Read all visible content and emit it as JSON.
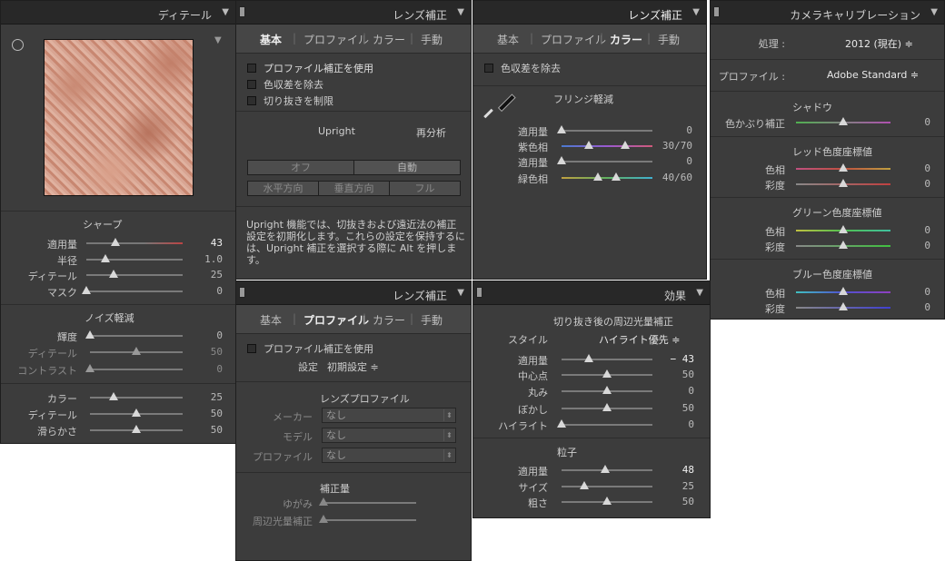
{
  "detail": {
    "title": "ディテール",
    "sharpen": {
      "title": "シャープ",
      "rows": [
        {
          "label": "適用量",
          "value": "43"
        },
        {
          "label": "半径",
          "value": "1.0"
        },
        {
          "label": "ディテール",
          "value": "25"
        },
        {
          "label": "マスク",
          "value": "0"
        }
      ]
    },
    "noise": {
      "title": "ノイズ軽減",
      "rows": [
        {
          "label": "輝度",
          "value": "0"
        },
        {
          "label": "ディテール",
          "value": "50"
        },
        {
          "label": "コントラスト",
          "value": "0"
        },
        {
          "label": "カラー",
          "value": "25"
        },
        {
          "label": "ディテール",
          "value": "50"
        },
        {
          "label": "滑らかさ",
          "value": "50"
        }
      ]
    }
  },
  "lens1": {
    "title": "レンズ補正",
    "tabs": [
      "基本",
      "プロファイル",
      "カラー",
      "手動"
    ],
    "active_tab": "基本",
    "checkboxes": [
      "プロファイル補正を使用",
      "色収差を除去",
      "切り抜きを制限"
    ],
    "upright": "Upright",
    "reanalyze": "再分析",
    "buttons_row1": [
      "オフ",
      "自動"
    ],
    "buttons_row2": [
      "水平方向",
      "垂直方向",
      "フル"
    ],
    "info": "Upright 機能では、切抜きおよび遠近法の補正設定を初期化します。これらの設定を保持するには、Upright 補正を選択する際に Alt を押します。"
  },
  "lens2": {
    "title": "レンズ補正",
    "tabs": [
      "基本",
      "プロファイル",
      "カラー",
      "手動"
    ],
    "active_tab": "カラー",
    "checkbox": "色収差を除去",
    "fringe_title": "フリンジ軽減",
    "rows": [
      {
        "label": "適用量",
        "value": "0"
      },
      {
        "label": "紫色相",
        "value": "30/70"
      },
      {
        "label": "適用量",
        "value": "0"
      },
      {
        "label": "緑色相",
        "value": "40/60"
      }
    ]
  },
  "lens3": {
    "title": "レンズ補正",
    "tabs": [
      "基本",
      "プロファイル",
      "カラー",
      "手動"
    ],
    "active_tab": "プロファイル",
    "checkbox": "プロファイル補正を使用",
    "setup_label": "設定",
    "setup_value": "初期設定 ≑",
    "lens_profile_title": "レンズプロファイル",
    "selects": [
      {
        "label": "メーカー",
        "value": "なし"
      },
      {
        "label": "モデル",
        "value": "なし"
      },
      {
        "label": "プロファイル",
        "value": "なし"
      }
    ],
    "amount_title": "補正量",
    "amount_rows": [
      {
        "label": "ゆがみ"
      },
      {
        "label": "周辺光量補正"
      }
    ]
  },
  "effects": {
    "title": "効果",
    "vignette_title": "切り抜き後の周辺光量補正",
    "style_label": "スタイル",
    "style_value": "ハイライト優先 ≑",
    "vignette_rows": [
      {
        "label": "適用量",
        "value": "− 43"
      },
      {
        "label": "中心点",
        "value": "50"
      },
      {
        "label": "丸み",
        "value": "0"
      },
      {
        "label": "ぼかし",
        "value": "50"
      },
      {
        "label": "ハイライト",
        "value": "0"
      }
    ],
    "grain_title": "粒子",
    "grain_rows": [
      {
        "label": "適用量",
        "value": "48"
      },
      {
        "label": "サイズ",
        "value": "25"
      },
      {
        "label": "粗さ",
        "value": "50"
      }
    ]
  },
  "camera": {
    "title": "カメラキャリブレーション",
    "process_label": "処理 :",
    "process_value": "2012 (現在) ≑",
    "profile_label": "プロファイル :",
    "profile_value": "Adobe Standard ≑",
    "shadow_title": "シャドウ",
    "shadow_row": {
      "label": "色かぶり補正",
      "value": "0"
    },
    "red_title": "レッド色度座標値",
    "green_title": "グリーン色度座標値",
    "blue_title": "ブルー色度座標値",
    "hue_label": "色相",
    "sat_label": "彩度",
    "values": [
      "0",
      "0",
      "0",
      "0",
      "0",
      "0"
    ]
  }
}
